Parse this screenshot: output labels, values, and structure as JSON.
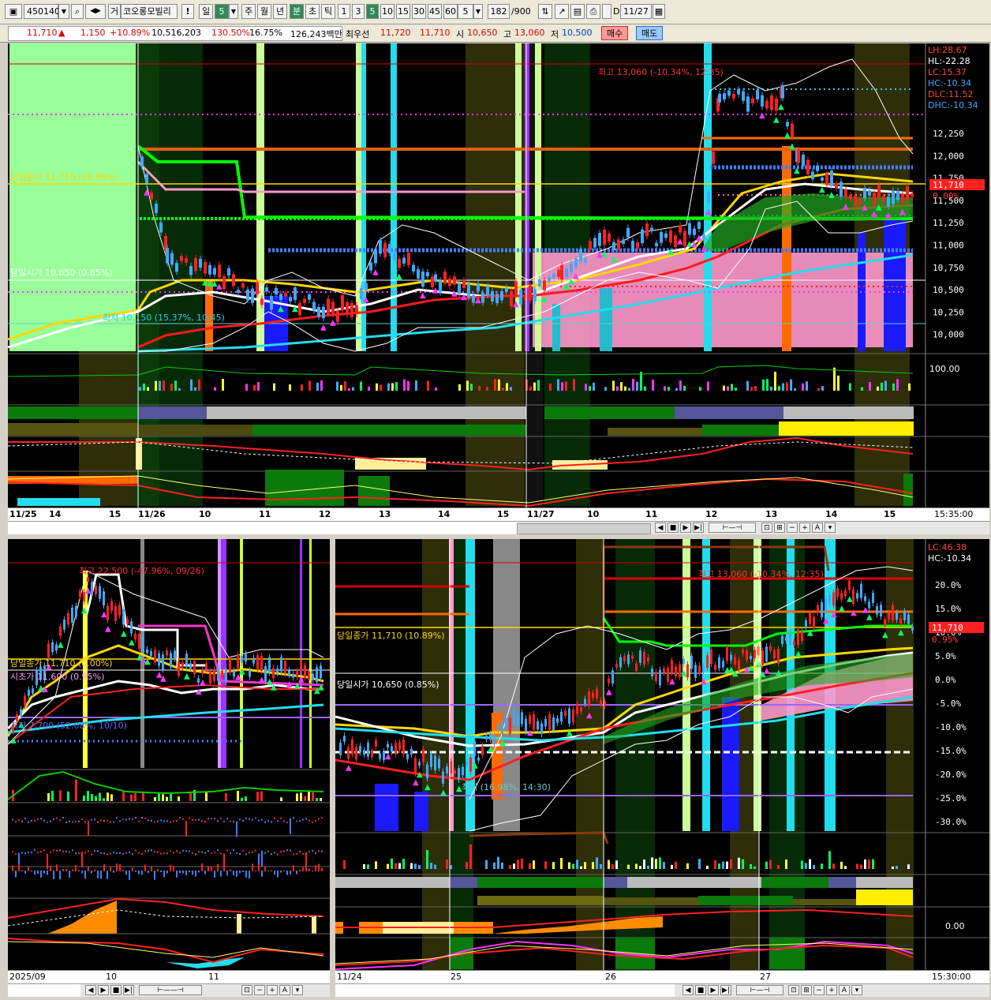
{
  "toolbar": {
    "code": "450140",
    "market": "거",
    "name": "코오롱모빌리",
    "excl": "!",
    "periods": [
      "일",
      "5",
      "주",
      "월",
      "년",
      "분",
      "초",
      "틱",
      "1",
      "3",
      "5",
      "10",
      "15",
      "30",
      "45",
      "60"
    ],
    "period_value": "5",
    "count": "182",
    "count_total": "/900",
    "d_label": "D",
    "date_value": "11/27"
  },
  "quote": {
    "price": "11,710",
    "arrow": "▲",
    "change": "1,150",
    "change_pct": "+10.89%",
    "volume": "10,516,203",
    "vol_ratio": "130.50%",
    "turnover": "16.75%",
    "amount": "126,243백만",
    "best_label": "최우선",
    "ask": "11,720",
    "bid": "11,710",
    "open_label": "시",
    "open": "10,650",
    "high_label": "고",
    "high": "13,060",
    "low_label": "저",
    "low": "10,500",
    "buy_label": "매수",
    "sell_label": "매도"
  },
  "top_chart": {
    "stats": [
      {
        "text": "LH:28.67",
        "color": "#ff4040"
      },
      {
        "text": "HL:-22.28",
        "color": "#ffffff"
      },
      {
        "text": "LC:15.37",
        "color": "#ff4040"
      },
      {
        "text": "HC:-10.34",
        "color": "#4da6ff"
      },
      {
        "text": "DLC:11.52",
        "color": "#ff4040"
      },
      {
        "text": "DHC:-10.34",
        "color": "#4da6ff"
      }
    ],
    "price_axis": [
      "12,250",
      "12,000",
      "11,750",
      "11,500",
      "11,250",
      "11,000",
      "10,750",
      "10,500",
      "10,250",
      "10,000"
    ],
    "current_price_tag": "11,710",
    "current_pct_tag": "0.00%",
    "high_annotation": "최고 13,060 (-10.34%, 12:35)",
    "low_annotation": "최저 10,150 (15.37%, 10:45)",
    "prev_close_label": "당일종가 11,710 (10.89%)",
    "open_label": "당일시가 10,650 (0.85%)",
    "volume_axis": "100.00",
    "time_axis": [
      "11/25",
      "14",
      "15",
      "11/26",
      "10",
      "11",
      "12",
      "13",
      "14",
      "15",
      "11/27",
      "10",
      "11",
      "12",
      "13",
      "14",
      "15"
    ],
    "clock": "15:35:00"
  },
  "bottom_left_chart": {
    "high_annotation": "최고 22,500 (-47.96%, 09/26)",
    "prev_close_label": "당일종가 11,710 (0.00%)",
    "open_label": "시초가 11,600 (0.95%)",
    "low_annotation": "최저 7,700 (52.08%, 10/10)",
    "time_axis": [
      "2025/09",
      "10",
      "11"
    ]
  },
  "bottom_right_chart": {
    "stats": [
      {
        "text": "LC:46.38",
        "color": "#ff4040"
      },
      {
        "text": "HC:-10.34",
        "color": "#ffffff"
      }
    ],
    "pct_axis": [
      "20.0%",
      "15.0%",
      "10.0%",
      "5.0%",
      "0.0%",
      "-5.0%",
      "-10.0%",
      "-15.0%",
      "-20.0%",
      "-25.0%",
      "-30.0%"
    ],
    "current_price_tag": "11,710",
    "current_pct_tag": "0.95%",
    "high_annotation": "최고 13,060 (-10.34%, 12:35)",
    "prev_close_label": "당일종가 11,710 (10.89%)",
    "open_label": "당일시가 10,650 (0.85%)",
    "low_annotation": "최저 (16.98%, 14:30)",
    "osc_axis": "0.00",
    "time_axis": [
      "11/24",
      "25",
      "26",
      "27"
    ],
    "clock": "15:30:00"
  },
  "colors": {
    "bg": "#000000",
    "up": "#ff2020",
    "down": "#3fa9ff",
    "ma_yellow": "#ffd700",
    "ma_green": "#00ff00",
    "ma_pink": "#ff80c0",
    "ma_cyan": "#22ccee",
    "pale_green": "#99ff99",
    "olive": "#3a3a0a",
    "dkgreen": "#0a3a0a"
  }
}
